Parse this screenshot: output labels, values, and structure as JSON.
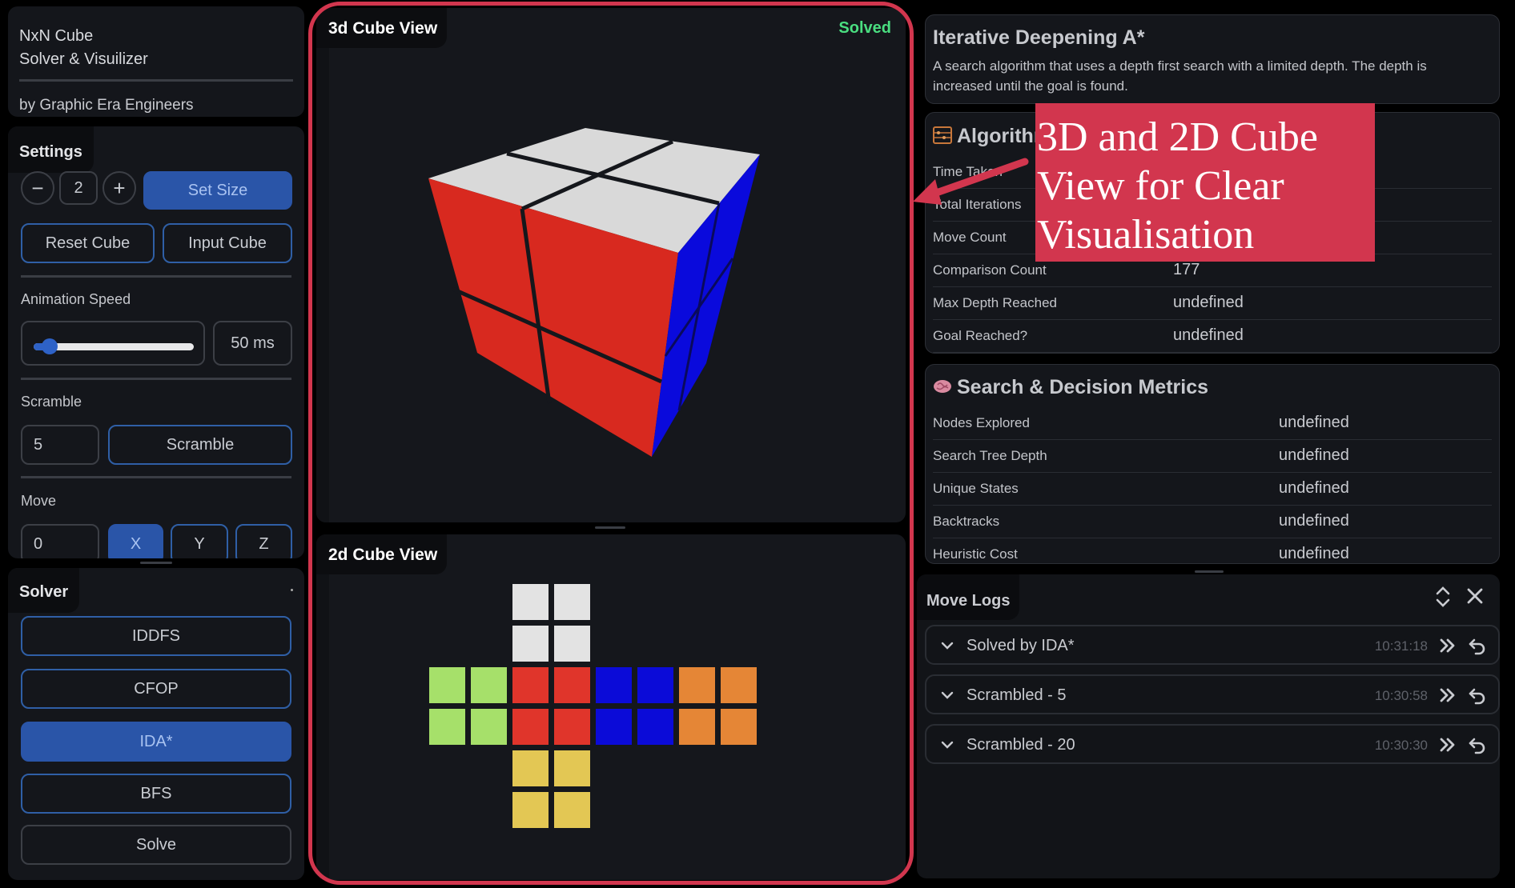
{
  "app": {
    "name": "NxN Cube",
    "subtitle": "Solver & Visuilizer",
    "credit": "by Graphic Era Engineers"
  },
  "settings": {
    "title": "Settings",
    "size_value": "2",
    "minus": "−",
    "plus": "+",
    "set_size": "Set Size",
    "reset": "Reset Cube",
    "input": "Input Cube",
    "anim_label": "Animation Speed",
    "anim_level": 0.1,
    "anim_value": "50 ms",
    "scramble_label": "Scramble",
    "scramble_count": "5",
    "scramble_btn": "Scramble",
    "move_label": "Move",
    "move_value": "0",
    "axes": [
      "X",
      "Y",
      "Z"
    ]
  },
  "solver": {
    "title": "Solver",
    "dot": ".",
    "buttons": [
      "IDDFS",
      "CFOP",
      "IDA*",
      "BFS",
      "Solve"
    ],
    "active": "IDA*"
  },
  "view3d": {
    "title": "3d Cube View",
    "status": "Solved"
  },
  "view2d": {
    "title": "2d Cube View"
  },
  "net_colors": {
    "top": "#e3e3e3",
    "left": "#a6e06a",
    "front": "#e0352b",
    "right": "#0b0bd8",
    "back": "#e58636",
    "bottom": "#e3c754"
  },
  "algorithm": {
    "name": "Iterative Deepening A*",
    "description": "A search algorithm that uses a depth first search with a limited depth. The depth is increased until the goal is found.",
    "section_title": "Algorithm",
    "rows": [
      {
        "k": "Time Taken",
        "v": ""
      },
      {
        "k": "Total Iterations",
        "v": ""
      },
      {
        "k": "Move Count",
        "v": ""
      },
      {
        "k": "Comparison Count",
        "v": "177"
      },
      {
        "k": "Max Depth Reached",
        "v": "undefined"
      },
      {
        "k": "Goal Reached?",
        "v": "undefined"
      }
    ]
  },
  "metrics": {
    "title": "Search & Decision Metrics",
    "rows": [
      {
        "k": "Nodes Explored",
        "v": "undefined"
      },
      {
        "k": "Search Tree Depth",
        "v": "undefined"
      },
      {
        "k": "Unique States",
        "v": "undefined"
      },
      {
        "k": "Backtracks",
        "v": "undefined"
      },
      {
        "k": "Heuristic Cost",
        "v": "undefined"
      }
    ]
  },
  "logs": {
    "title": "Move Logs",
    "items": [
      {
        "name": "Solved by IDA*",
        "time": "10:31:18"
      },
      {
        "name": "Scrambled - 5",
        "time": "10:30:58"
      },
      {
        "name": "Scrambled - 20",
        "time": "10:30:30"
      }
    ]
  },
  "annotation": {
    "text": "3D and 2D Cube View for Clear Visualisation",
    "color": "#d2364e"
  },
  "icons": {
    "brain": "brain-icon",
    "abacus": "abacus-icon",
    "expand": "expand-collapse-icon",
    "close": "close-icon",
    "chevron": "chevron-down-icon",
    "fast_forward": "fast-forward-icon",
    "undo": "undo-icon"
  }
}
